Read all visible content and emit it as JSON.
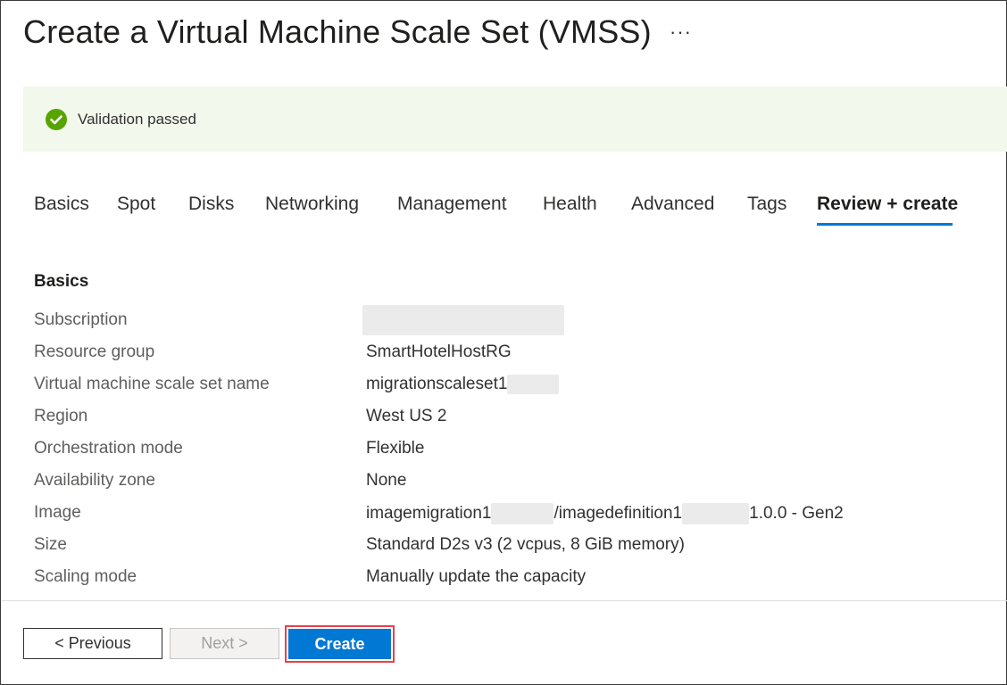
{
  "page": {
    "title": "Create a Virtual Machine Scale Set (VMSS)",
    "more_label": "···"
  },
  "banner": {
    "text": "Validation passed",
    "icon": "check-circle-icon",
    "color": "#57a300"
  },
  "tabs": [
    {
      "label": "Basics",
      "active": false
    },
    {
      "label": "Spot",
      "active": false
    },
    {
      "label": "Disks",
      "active": false
    },
    {
      "label": "Networking",
      "active": false
    },
    {
      "label": "Management",
      "active": false
    },
    {
      "label": "Health",
      "active": false
    },
    {
      "label": "Advanced",
      "active": false
    },
    {
      "label": "Tags",
      "active": false
    },
    {
      "label": "Review + create",
      "active": true
    }
  ],
  "section": {
    "title": "Basics",
    "rows": [
      {
        "label": "Subscription",
        "value": ""
      },
      {
        "label": "Resource group",
        "value": "SmartHotelHostRG"
      },
      {
        "label": "Virtual machine scale set name",
        "value": "migrationscaleset1"
      },
      {
        "label": "Region",
        "value": "West US 2"
      },
      {
        "label": "Orchestration mode",
        "value": "Flexible"
      },
      {
        "label": "Availability zone",
        "value": "None"
      },
      {
        "label": "Image",
        "value_parts": [
          "imagemigration1",
          "/imagedefinition1",
          "1.0.0 - Gen2"
        ]
      },
      {
        "label": "Size",
        "value": "Standard D2s v3 (2 vcpus, 8 GiB memory)"
      },
      {
        "label": "Scaling mode",
        "value": "Manually update the capacity"
      }
    ]
  },
  "footer": {
    "previous_label": "< Previous",
    "next_label": "Next >",
    "create_label": "Create",
    "accent": "#0078d4",
    "highlight": "#e8414b"
  }
}
